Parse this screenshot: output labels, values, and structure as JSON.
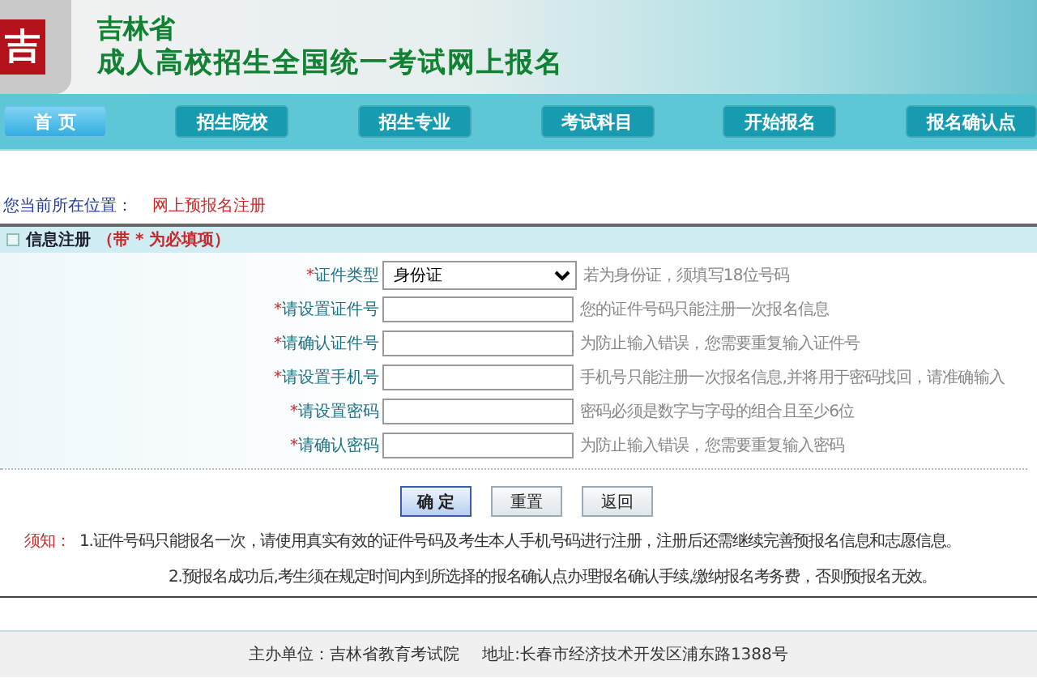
{
  "header": {
    "logo_char": "吉",
    "province": "吉林省",
    "title": "成人高校招生全国统一考试网上报名"
  },
  "nav": [
    {
      "label": "首 页",
      "selected": true
    },
    {
      "label": "招生院校",
      "selected": false
    },
    {
      "label": "招生专业",
      "selected": false
    },
    {
      "label": "考试科目",
      "selected": false
    },
    {
      "label": "开始报名",
      "selected": false
    },
    {
      "label": "报名确认点",
      "selected": false
    }
  ],
  "breadcrumb": {
    "label": "您当前所在位置：",
    "current": "网上预报名注册"
  },
  "section": {
    "title": "信息注册",
    "note": "（带 * 为必填项）"
  },
  "required_mark": "*",
  "fields": [
    {
      "label": "证件类型",
      "required": true,
      "kind": "select",
      "value": "身份证",
      "hint": "若为身份证，须填写18位号码"
    },
    {
      "label": "请设置证件号",
      "required": true,
      "kind": "input",
      "hint": "您的证件号码只能注册一次报名信息"
    },
    {
      "label": "请确认证件号",
      "required": true,
      "kind": "input",
      "hint": "为防止输入错误，您需要重复输入证件号"
    },
    {
      "label": "请设置手机号",
      "required": true,
      "kind": "input",
      "hint": "手机号只能注册一次报名信息,并将用于密码找回，请准确输入"
    },
    {
      "label": "请设置密码",
      "required": true,
      "kind": "password",
      "hint": "密码必须是数字与字母的组合且至少6位"
    },
    {
      "label": "请确认密码",
      "required": true,
      "kind": "password",
      "hint": "为防止输入错误，您需要重复输入密码"
    }
  ],
  "buttons": [
    {
      "label": "确 定",
      "primary": true
    },
    {
      "label": "重置",
      "primary": false
    },
    {
      "label": "返回",
      "primary": false
    }
  ],
  "notice": {
    "label": "须知：",
    "items": [
      "1.证件号码只能报名一次，请使用真实有效的证件号码及考生本人手机号码进行注册，注册后还需继续完善预报名信息和志愿信息。",
      "2.预报名成功后,考生须在规定时间内到所选择的报名确认点办理报名确认手续,缴纳报名考务费，否则预报名无效。"
    ]
  },
  "footer": {
    "organizer": "主办单位：吉林省教育考试院",
    "address": "地址:长春市经济技术开发区浦东路1388号"
  }
}
